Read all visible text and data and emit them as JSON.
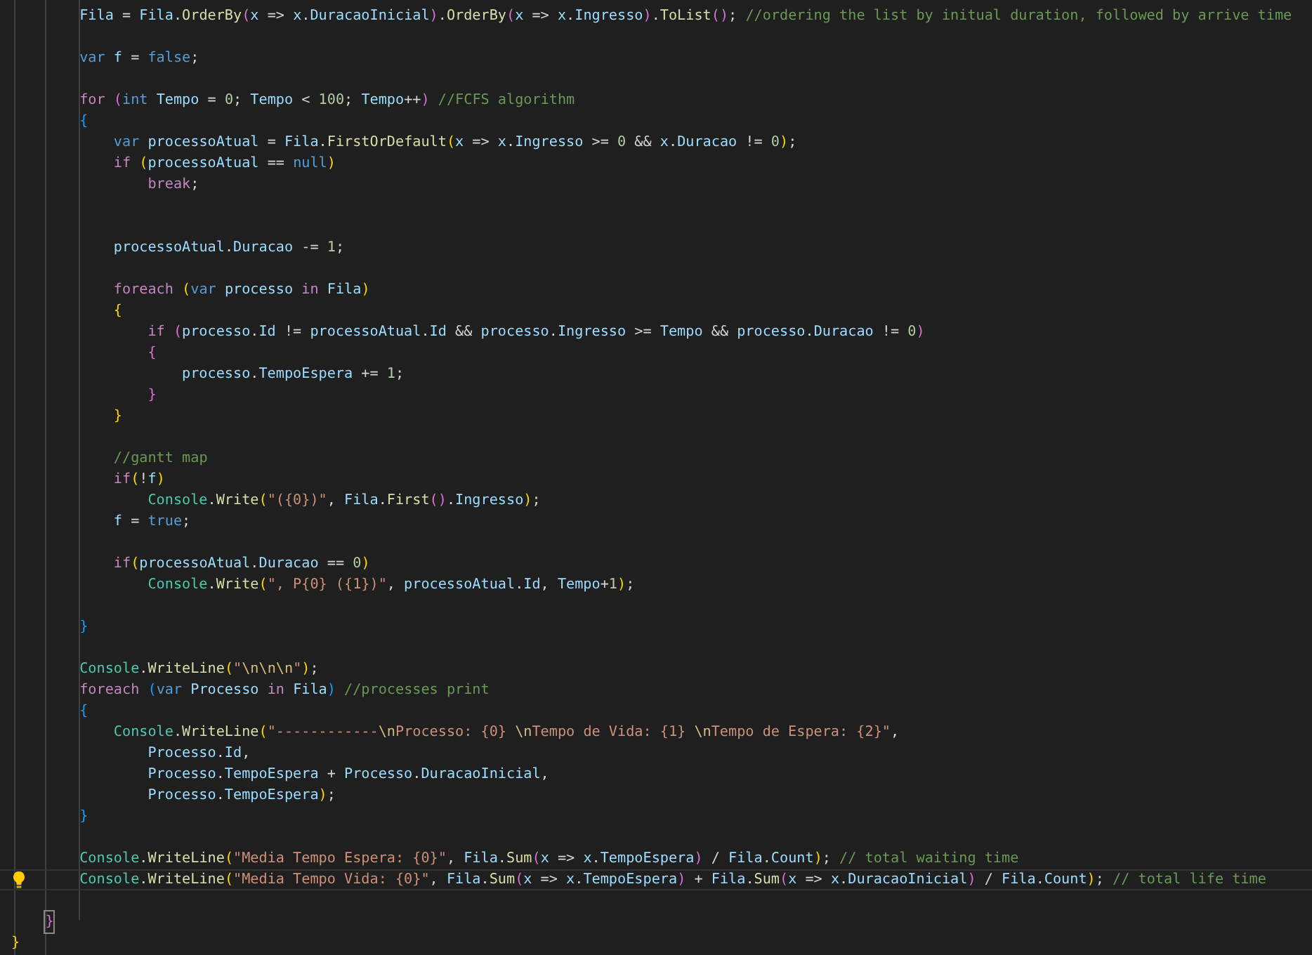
{
  "editor": {
    "lines": [
      {
        "kind": "code",
        "current": false,
        "tokens": [
          {
            "kind": "id",
            "text": "Fila"
          },
          {
            "kind": "p",
            "text": " = "
          },
          {
            "kind": "id",
            "text": "Fila"
          },
          {
            "kind": "p",
            "text": "."
          },
          {
            "kind": "fn",
            "text": "OrderBy"
          },
          {
            "kind": "b2",
            "text": "("
          },
          {
            "kind": "id",
            "text": "x"
          },
          {
            "kind": "p",
            "text": " => "
          },
          {
            "kind": "id",
            "text": "x"
          },
          {
            "kind": "p",
            "text": "."
          },
          {
            "kind": "id",
            "text": "DuracaoInicial"
          },
          {
            "kind": "b2",
            "text": ")"
          },
          {
            "kind": "p",
            "text": "."
          },
          {
            "kind": "fn",
            "text": "OrderBy"
          },
          {
            "kind": "b2",
            "text": "("
          },
          {
            "kind": "id",
            "text": "x"
          },
          {
            "kind": "p",
            "text": " => "
          },
          {
            "kind": "id",
            "text": "x"
          },
          {
            "kind": "p",
            "text": "."
          },
          {
            "kind": "id",
            "text": "Ingresso"
          },
          {
            "kind": "b2",
            "text": ")"
          },
          {
            "kind": "p",
            "text": "."
          },
          {
            "kind": "fn",
            "text": "ToList"
          },
          {
            "kind": "b2",
            "text": "()"
          },
          {
            "kind": "p",
            "text": "; "
          },
          {
            "kind": "com",
            "text": "//ordering the list by initual duration, followed by arrive time"
          }
        ]
      },
      {
        "kind": "blank",
        "current": false
      },
      {
        "kind": "code",
        "current": false,
        "tokens": [
          {
            "kind": "st",
            "text": "var "
          },
          {
            "kind": "id",
            "text": "f"
          },
          {
            "kind": "p",
            "text": " = "
          },
          {
            "kind": "st",
            "text": "false"
          },
          {
            "kind": "p",
            "text": ";"
          }
        ]
      },
      {
        "kind": "blank",
        "current": false
      },
      {
        "kind": "code",
        "current": false,
        "tokens": [
          {
            "kind": "kw",
            "text": "for "
          },
          {
            "kind": "b2",
            "text": "("
          },
          {
            "kind": "st",
            "text": "int "
          },
          {
            "kind": "id",
            "text": "Tempo"
          },
          {
            "kind": "p",
            "text": " = "
          },
          {
            "kind": "num",
            "text": "0"
          },
          {
            "kind": "p",
            "text": "; "
          },
          {
            "kind": "id",
            "text": "Tempo"
          },
          {
            "kind": "p",
            "text": " < "
          },
          {
            "kind": "num",
            "text": "100"
          },
          {
            "kind": "p",
            "text": "; "
          },
          {
            "kind": "id",
            "text": "Tempo"
          },
          {
            "kind": "p",
            "text": "++"
          },
          {
            "kind": "b2",
            "text": ") "
          },
          {
            "kind": "com",
            "text": "//FCFS algorithm"
          }
        ]
      },
      {
        "kind": "code",
        "current": false,
        "tokens": [
          {
            "kind": "b3",
            "text": "{"
          }
        ],
        "children": [
          {
            "kind": "code",
            "current": false,
            "tokens": [
              {
                "kind": "st",
                "text": "var "
              },
              {
                "kind": "id",
                "text": "processoAtual"
              },
              {
                "kind": "p",
                "text": " = "
              },
              {
                "kind": "id",
                "text": "Fila"
              },
              {
                "kind": "p",
                "text": "."
              },
              {
                "kind": "fn",
                "text": "FirstOrDefault"
              },
              {
                "kind": "b1",
                "text": "("
              },
              {
                "kind": "id",
                "text": "x"
              },
              {
                "kind": "p",
                "text": " => "
              },
              {
                "kind": "id",
                "text": "x"
              },
              {
                "kind": "p",
                "text": "."
              },
              {
                "kind": "id",
                "text": "Ingresso"
              },
              {
                "kind": "p",
                "text": " >= "
              },
              {
                "kind": "num",
                "text": "0"
              },
              {
                "kind": "p",
                "text": " && "
              },
              {
                "kind": "id",
                "text": "x"
              },
              {
                "kind": "p",
                "text": "."
              },
              {
                "kind": "id",
                "text": "Duracao"
              },
              {
                "kind": "p",
                "text": " != "
              },
              {
                "kind": "num",
                "text": "0"
              },
              {
                "kind": "b1",
                "text": ")"
              },
              {
                "kind": "p",
                "text": ";"
              }
            ]
          },
          {
            "kind": "code",
            "current": false,
            "tokens": [
              {
                "kind": "kw",
                "text": "if "
              },
              {
                "kind": "b1",
                "text": "("
              },
              {
                "kind": "id",
                "text": "processoAtual"
              },
              {
                "kind": "p",
                "text": " == "
              },
              {
                "kind": "st",
                "text": "null"
              },
              {
                "kind": "b1",
                "text": ")"
              }
            ],
            "children": [
              {
                "kind": "code",
                "current": false,
                "tokens": [
                  {
                    "kind": "kw",
                    "text": "break"
                  },
                  {
                    "kind": "p",
                    "text": ";"
                  }
                ]
              },
              {
                "kind": "blank",
                "current": false
              },
              {
                "kind": "blank",
                "current": false
              }
            ]
          },
          {
            "kind": "code",
            "current": false,
            "tokens": [
              {
                "kind": "id",
                "text": "processoAtual"
              },
              {
                "kind": "p",
                "text": "."
              },
              {
                "kind": "id",
                "text": "Duracao"
              },
              {
                "kind": "p",
                "text": " -= "
              },
              {
                "kind": "num",
                "text": "1"
              },
              {
                "kind": "p",
                "text": ";"
              }
            ]
          },
          {
            "kind": "blank",
            "current": false
          },
          {
            "kind": "code",
            "current": false,
            "tokens": [
              {
                "kind": "kw",
                "text": "foreach "
              },
              {
                "kind": "b1",
                "text": "("
              },
              {
                "kind": "st",
                "text": "var "
              },
              {
                "kind": "id",
                "text": "processo "
              },
              {
                "kind": "kw",
                "text": "in "
              },
              {
                "kind": "id",
                "text": "Fila"
              },
              {
                "kind": "b1",
                "text": ")"
              }
            ]
          },
          {
            "kind": "code",
            "current": false,
            "tokens": [
              {
                "kind": "b1",
                "text": "{"
              }
            ],
            "children": [
              {
                "kind": "code",
                "current": false,
                "tokens": [
                  {
                    "kind": "kw",
                    "text": "if "
                  },
                  {
                    "kind": "b2",
                    "text": "("
                  },
                  {
                    "kind": "id",
                    "text": "processo"
                  },
                  {
                    "kind": "p",
                    "text": "."
                  },
                  {
                    "kind": "id",
                    "text": "Id"
                  },
                  {
                    "kind": "p",
                    "text": " != "
                  },
                  {
                    "kind": "id",
                    "text": "processoAtual"
                  },
                  {
                    "kind": "p",
                    "text": "."
                  },
                  {
                    "kind": "id",
                    "text": "Id"
                  },
                  {
                    "kind": "p",
                    "text": " && "
                  },
                  {
                    "kind": "id",
                    "text": "processo"
                  },
                  {
                    "kind": "p",
                    "text": "."
                  },
                  {
                    "kind": "id",
                    "text": "Ingresso"
                  },
                  {
                    "kind": "p",
                    "text": " >= "
                  },
                  {
                    "kind": "id",
                    "text": "Tempo"
                  },
                  {
                    "kind": "p",
                    "text": " && "
                  },
                  {
                    "kind": "id",
                    "text": "processo"
                  },
                  {
                    "kind": "p",
                    "text": "."
                  },
                  {
                    "kind": "id",
                    "text": "Duracao"
                  },
                  {
                    "kind": "p",
                    "text": " != "
                  },
                  {
                    "kind": "num",
                    "text": "0"
                  },
                  {
                    "kind": "b2",
                    "text": ")"
                  }
                ]
              },
              {
                "kind": "code",
                "current": false,
                "tokens": [
                  {
                    "kind": "b2",
                    "text": "{"
                  }
                ],
                "children": [
                  {
                    "kind": "code",
                    "current": false,
                    "tokens": [
                      {
                        "kind": "id",
                        "text": "processo"
                      },
                      {
                        "kind": "p",
                        "text": "."
                      },
                      {
                        "kind": "id",
                        "text": "TempoEspera"
                      },
                      {
                        "kind": "p",
                        "text": " += "
                      },
                      {
                        "kind": "num",
                        "text": "1"
                      },
                      {
                        "kind": "p",
                        "text": ";"
                      }
                    ]
                  }
                ]
              },
              {
                "kind": "code",
                "current": false,
                "tokens": [
                  {
                    "kind": "b2",
                    "text": "}"
                  }
                ]
              }
            ]
          },
          {
            "kind": "code",
            "current": false,
            "tokens": [
              {
                "kind": "b1",
                "text": "}"
              }
            ]
          },
          {
            "kind": "blank",
            "current": false
          },
          {
            "kind": "code",
            "current": false,
            "tokens": [
              {
                "kind": "com",
                "text": "//gantt map"
              }
            ]
          },
          {
            "kind": "code",
            "current": false,
            "tokens": [
              {
                "kind": "kw",
                "text": "if"
              },
              {
                "kind": "b1",
                "text": "("
              },
              {
                "kind": "p",
                "text": "!"
              },
              {
                "kind": "id",
                "text": "f"
              },
              {
                "kind": "b1",
                "text": ")"
              }
            ],
            "children": [
              {
                "kind": "code",
                "current": false,
                "tokens": [
                  {
                    "kind": "ty",
                    "text": "Console"
                  },
                  {
                    "kind": "p",
                    "text": "."
                  },
                  {
                    "kind": "fn",
                    "text": "Write"
                  },
                  {
                    "kind": "b1",
                    "text": "("
                  },
                  {
                    "kind": "str",
                    "text": "\"({0})\""
                  },
                  {
                    "kind": "p",
                    "text": ", "
                  },
                  {
                    "kind": "id",
                    "text": "Fila"
                  },
                  {
                    "kind": "p",
                    "text": "."
                  },
                  {
                    "kind": "fn",
                    "text": "First"
                  },
                  {
                    "kind": "b2",
                    "text": "()"
                  },
                  {
                    "kind": "p",
                    "text": "."
                  },
                  {
                    "kind": "id",
                    "text": "Ingresso"
                  },
                  {
                    "kind": "b1",
                    "text": ")"
                  },
                  {
                    "kind": "p",
                    "text": ";"
                  }
                ]
              }
            ]
          },
          {
            "kind": "code",
            "current": false,
            "tokens": [
              {
                "kind": "id",
                "text": "f"
              },
              {
                "kind": "p",
                "text": " = "
              },
              {
                "kind": "st",
                "text": "true"
              },
              {
                "kind": "p",
                "text": ";"
              }
            ]
          },
          {
            "kind": "blank",
            "current": false
          },
          {
            "kind": "code",
            "current": false,
            "tokens": [
              {
                "kind": "kw",
                "text": "if"
              },
              {
                "kind": "b1",
                "text": "("
              },
              {
                "kind": "id",
                "text": "processoAtual"
              },
              {
                "kind": "p",
                "text": "."
              },
              {
                "kind": "id",
                "text": "Duracao"
              },
              {
                "kind": "p",
                "text": " == "
              },
              {
                "kind": "num",
                "text": "0"
              },
              {
                "kind": "b1",
                "text": ")"
              }
            ],
            "children": [
              {
                "kind": "code",
                "current": false,
                "tokens": [
                  {
                    "kind": "ty",
                    "text": "Console"
                  },
                  {
                    "kind": "p",
                    "text": "."
                  },
                  {
                    "kind": "fn",
                    "text": "Write"
                  },
                  {
                    "kind": "b1",
                    "text": "("
                  },
                  {
                    "kind": "str",
                    "text": "\", P{0} ({1})\""
                  },
                  {
                    "kind": "p",
                    "text": ", "
                  },
                  {
                    "kind": "id",
                    "text": "processoAtual"
                  },
                  {
                    "kind": "p",
                    "text": "."
                  },
                  {
                    "kind": "id",
                    "text": "Id"
                  },
                  {
                    "kind": "p",
                    "text": ", "
                  },
                  {
                    "kind": "id",
                    "text": "Tempo"
                  },
                  {
                    "kind": "p",
                    "text": "+"
                  },
                  {
                    "kind": "num",
                    "text": "1"
                  },
                  {
                    "kind": "b1",
                    "text": ")"
                  },
                  {
                    "kind": "p",
                    "text": ";"
                  }
                ]
              }
            ]
          },
          {
            "kind": "blank",
            "current": false
          }
        ]
      },
      {
        "kind": "code",
        "current": false,
        "tokens": [
          {
            "kind": "b3",
            "text": "}"
          }
        ]
      },
      {
        "kind": "blank",
        "current": false
      },
      {
        "kind": "code",
        "current": false,
        "tokens": [
          {
            "kind": "ty",
            "text": "Console"
          },
          {
            "kind": "p",
            "text": "."
          },
          {
            "kind": "fn",
            "text": "WriteLine"
          },
          {
            "kind": "b1",
            "text": "("
          },
          {
            "kind": "str",
            "text": "\""
          },
          {
            "kind": "esc",
            "text": "\\n\\n\\n"
          },
          {
            "kind": "str",
            "text": "\""
          },
          {
            "kind": "b1",
            "text": ")"
          },
          {
            "kind": "p",
            "text": ";"
          }
        ]
      },
      {
        "kind": "code",
        "current": false,
        "tokens": [
          {
            "kind": "kw",
            "text": "foreach "
          },
          {
            "kind": "b3",
            "text": "("
          },
          {
            "kind": "st",
            "text": "var "
          },
          {
            "kind": "id",
            "text": "Processo "
          },
          {
            "kind": "kw",
            "text": "in "
          },
          {
            "kind": "id",
            "text": "Fila"
          },
          {
            "kind": "b3",
            "text": ") "
          },
          {
            "kind": "com",
            "text": "//processes print"
          }
        ]
      },
      {
        "kind": "code",
        "current": false,
        "tokens": [
          {
            "kind": "b3",
            "text": "{"
          }
        ],
        "children": [
          {
            "kind": "code",
            "current": false,
            "tokens": [
              {
                "kind": "ty",
                "text": "Console"
              },
              {
                "kind": "p",
                "text": "."
              },
              {
                "kind": "fn",
                "text": "WriteLine"
              },
              {
                "kind": "b1",
                "text": "("
              },
              {
                "kind": "str",
                "text": "\"------------"
              },
              {
                "kind": "esc",
                "text": "\\n"
              },
              {
                "kind": "str",
                "text": "Processo: {0} "
              },
              {
                "kind": "esc",
                "text": "\\n"
              },
              {
                "kind": "str",
                "text": "Tempo de Vida: {1} "
              },
              {
                "kind": "esc",
                "text": "\\n"
              },
              {
                "kind": "str",
                "text": "Tempo de Espera: {2}\""
              },
              {
                "kind": "p",
                "text": ","
              }
            ],
            "children": [
              {
                "kind": "code",
                "current": false,
                "tokens": [
                  {
                    "kind": "id",
                    "text": "Processo"
                  },
                  {
                    "kind": "p",
                    "text": "."
                  },
                  {
                    "kind": "id",
                    "text": "Id"
                  },
                  {
                    "kind": "p",
                    "text": ","
                  }
                ]
              },
              {
                "kind": "code",
                "current": false,
                "tokens": [
                  {
                    "kind": "id",
                    "text": "Processo"
                  },
                  {
                    "kind": "p",
                    "text": "."
                  },
                  {
                    "kind": "id",
                    "text": "TempoEspera"
                  },
                  {
                    "kind": "p",
                    "text": " + "
                  },
                  {
                    "kind": "id",
                    "text": "Processo"
                  },
                  {
                    "kind": "p",
                    "text": "."
                  },
                  {
                    "kind": "id",
                    "text": "DuracaoInicial"
                  },
                  {
                    "kind": "p",
                    "text": ","
                  }
                ]
              },
              {
                "kind": "code",
                "current": false,
                "tokens": [
                  {
                    "kind": "id",
                    "text": "Processo"
                  },
                  {
                    "kind": "p",
                    "text": "."
                  },
                  {
                    "kind": "id",
                    "text": "TempoEspera"
                  },
                  {
                    "kind": "b1",
                    "text": ")"
                  },
                  {
                    "kind": "p",
                    "text": ";"
                  }
                ]
              }
            ]
          }
        ]
      },
      {
        "kind": "code",
        "current": false,
        "tokens": [
          {
            "kind": "b3",
            "text": "}"
          }
        ]
      },
      {
        "kind": "blank",
        "current": false
      },
      {
        "kind": "code",
        "current": false,
        "tokens": [
          {
            "kind": "ty",
            "text": "Console"
          },
          {
            "kind": "p",
            "text": "."
          },
          {
            "kind": "fn",
            "text": "WriteLine"
          },
          {
            "kind": "b1",
            "text": "("
          },
          {
            "kind": "str",
            "text": "\"Media Tempo Espera: {0}\""
          },
          {
            "kind": "p",
            "text": ", "
          },
          {
            "kind": "id",
            "text": "Fila"
          },
          {
            "kind": "p",
            "text": "."
          },
          {
            "kind": "fn",
            "text": "Sum"
          },
          {
            "kind": "b2",
            "text": "("
          },
          {
            "kind": "id",
            "text": "x"
          },
          {
            "kind": "p",
            "text": " => "
          },
          {
            "kind": "id",
            "text": "x"
          },
          {
            "kind": "p",
            "text": "."
          },
          {
            "kind": "id",
            "text": "TempoEspera"
          },
          {
            "kind": "b2",
            "text": ")"
          },
          {
            "kind": "p",
            "text": " / "
          },
          {
            "kind": "id",
            "text": "Fila"
          },
          {
            "kind": "p",
            "text": "."
          },
          {
            "kind": "id",
            "text": "Count"
          },
          {
            "kind": "b1",
            "text": ")"
          },
          {
            "kind": "p",
            "text": "; "
          },
          {
            "kind": "com",
            "text": "// total waiting time"
          }
        ]
      },
      {
        "kind": "code",
        "current": true,
        "lightbulb": true,
        "tokens": [
          {
            "kind": "ty",
            "text": "Console"
          },
          {
            "kind": "p",
            "text": "."
          },
          {
            "kind": "fn",
            "text": "WriteLine"
          },
          {
            "kind": "b1",
            "text": "("
          },
          {
            "kind": "str",
            "text": "\"Media Tempo Vida: {0}\""
          },
          {
            "kind": "p",
            "text": ", "
          },
          {
            "kind": "id",
            "text": "Fila"
          },
          {
            "kind": "p",
            "text": "."
          },
          {
            "kind": "fn",
            "text": "Sum"
          },
          {
            "kind": "b2",
            "text": "("
          },
          {
            "kind": "id",
            "text": "x"
          },
          {
            "kind": "p",
            "text": " => "
          },
          {
            "kind": "id",
            "text": "x"
          },
          {
            "kind": "p",
            "text": "."
          },
          {
            "kind": "id",
            "text": "TempoEspera"
          },
          {
            "kind": "b2",
            "text": ")"
          },
          {
            "kind": "p",
            "text": " + "
          },
          {
            "kind": "id",
            "text": "Fila"
          },
          {
            "kind": "p",
            "text": "."
          },
          {
            "kind": "fn",
            "text": "Sum"
          },
          {
            "kind": "b2",
            "text": "("
          },
          {
            "kind": "id",
            "text": "x"
          },
          {
            "kind": "p",
            "text": " => "
          },
          {
            "kind": "id",
            "text": "x"
          },
          {
            "kind": "p",
            "text": "."
          },
          {
            "kind": "id",
            "text": "DuracaoInicial"
          },
          {
            "kind": "b2",
            "text": ")"
          },
          {
            "kind": "p",
            "text": " / "
          },
          {
            "kind": "id",
            "text": "Fila"
          },
          {
            "kind": "p",
            "text": "."
          },
          {
            "kind": "id",
            "text": "Count"
          },
          {
            "kind": "b1",
            "text": ")"
          },
          {
            "kind": "p",
            "text": "; "
          },
          {
            "kind": "com",
            "text": "// total life time"
          }
        ]
      },
      {
        "kind": "blank",
        "current": false
      }
    ],
    "closing_braces": [
      {
        "kind": "code",
        "current": false,
        "tokens": [
          {
            "kind": "bm",
            "text": "}"
          }
        ]
      },
      {
        "kind": "code",
        "current": false,
        "tokens": [
          {
            "kind": "b1",
            "text": "}"
          }
        ]
      }
    ]
  }
}
